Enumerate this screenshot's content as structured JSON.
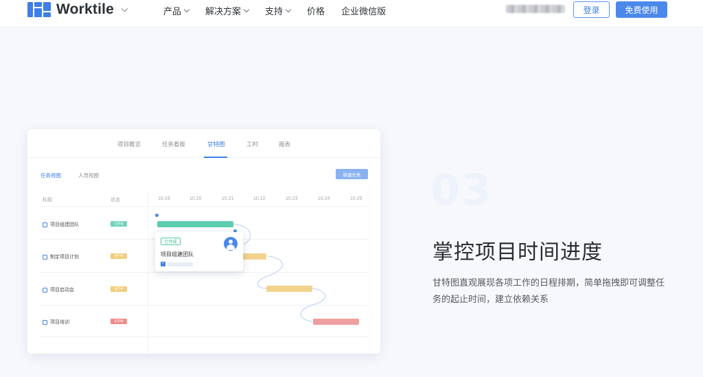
{
  "nav": {
    "logo_text": "Worktile",
    "menu": [
      {
        "label": "产品",
        "has_dropdown": true
      },
      {
        "label": "解决方案",
        "has_dropdown": true
      },
      {
        "label": "支持",
        "has_dropdown": true
      },
      {
        "label": "价格",
        "has_dropdown": false
      },
      {
        "label": "企业微信版",
        "has_dropdown": false
      }
    ],
    "login_label": "登录",
    "free_label": "免费使用"
  },
  "card": {
    "tabs": [
      "项目概览",
      "任务看板",
      "甘特图",
      "工时",
      "报表"
    ],
    "active_tab": "甘特图",
    "views": [
      "任务视图",
      "人员视图"
    ],
    "new_task_label": "新建任务",
    "col_title": "标题",
    "col_status": "状态",
    "dates": [
      "10.19",
      "10.20",
      "10.21",
      "10.22",
      "10.23",
      "10.24",
      "10.25"
    ],
    "rows": [
      {
        "title": "项目组建团队",
        "status": "已完成",
        "status_color": "#6fd3b7",
        "bar_color": "#5ccdb1"
      },
      {
        "title": "制定项目计划",
        "status": "进行中",
        "status_color": "#f2cc7a",
        "bar_color": "#f2d38c"
      },
      {
        "title": "项目启动会",
        "status": "进行中",
        "status_color": "#f2cc7a",
        "bar_color": "#f2d38c"
      },
      {
        "title": "项目培训",
        "status": "未开始",
        "status_color": "#ef8a8a",
        "bar_color": "#ef9f9f"
      }
    ],
    "popup": {
      "badge": "已完成",
      "title": "项目组建团队"
    }
  },
  "feature": {
    "number": "03",
    "headline": "掌控项目时间进度",
    "description": "甘特图直观展现各项工作的日程排期，简单拖拽即可调整任务的起止时间，建立依赖关系"
  }
}
